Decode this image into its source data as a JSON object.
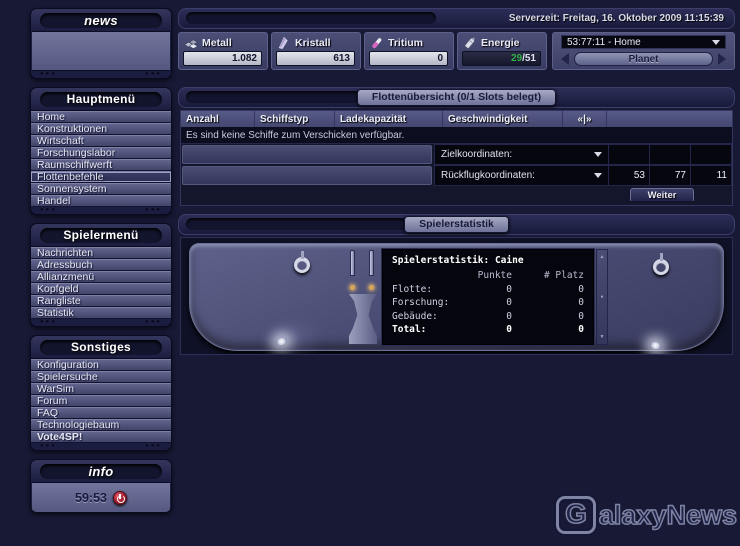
{
  "colors": {
    "background": "#171935",
    "panel_border": "#3c3f6b",
    "tab_silver": "#a6aac4",
    "energy_green": "#2fae47",
    "power_red": "#a11c2d",
    "selected_outline": "#9ba0c4",
    "decor_amber": "#d8a65a"
  },
  "sidebar": {
    "news_title": "news",
    "sections": [
      {
        "title": "Hauptmenü",
        "items": [
          {
            "label": "Home"
          },
          {
            "label": "Konstruktionen"
          },
          {
            "label": "Wirtschaft"
          },
          {
            "label": "Forschungslabor"
          },
          {
            "label": "Raumschiffwerft"
          },
          {
            "label": "Flottenbefehle",
            "selected": true
          },
          {
            "label": "Sonnensystem"
          },
          {
            "label": "Handel"
          }
        ]
      },
      {
        "title": "Spielermenü",
        "items": [
          {
            "label": "Nachrichten"
          },
          {
            "label": "Adressbuch"
          },
          {
            "label": "Allianzmenü"
          },
          {
            "label": "Kopfgeld"
          },
          {
            "label": "Rangliste"
          },
          {
            "label": "Statistik"
          }
        ]
      },
      {
        "title": "Sonstiges",
        "items": [
          {
            "label": "Konfiguration"
          },
          {
            "label": "Spielersuche"
          },
          {
            "label": "WarSim"
          },
          {
            "label": "Forum"
          },
          {
            "label": "FAQ"
          },
          {
            "label": "Technologiebaum"
          },
          {
            "label": "Vote4SP!",
            "bold": true
          }
        ]
      }
    ],
    "info": {
      "title": "info",
      "timer": "59:53",
      "power_icon": "power-icon"
    }
  },
  "topbar": {
    "server_time": "Serverzeit: Freitag, 16. Oktober 2009 11:15:39"
  },
  "resources": [
    {
      "label": "Metall",
      "value": "1.082",
      "icon": "metall-icon"
    },
    {
      "label": "Kristall",
      "value": "613",
      "icon": "kristall-icon"
    },
    {
      "label": "Tritium",
      "value": "0",
      "icon": "tritium-icon"
    },
    {
      "label": "Energie",
      "value_current": "29",
      "value_max": "/51",
      "icon": "energie-icon"
    }
  ],
  "planet": {
    "selected": "53:77:11 - Home",
    "button_label": "Planet",
    "dropdown_icon": "chevron-down-icon",
    "prev_icon": "planet-prev-arrow",
    "next_icon": "planet-next-arrow"
  },
  "fleet": {
    "title": "Flottenübersicht (0/1 Slots belegt)",
    "columns": [
      "Anzahl",
      "Schiffstyp",
      "Ladekapazität",
      "Geschwindigkeit"
    ],
    "pager": "«|»",
    "empty_message": "Es sind keine Schiffe zum Verschicken verfügbar.",
    "rows": [
      {
        "key": "target",
        "label": "Zielkoordinaten:",
        "coords": [
          "",
          "",
          ""
        ]
      },
      {
        "key": "return",
        "label": "Rückflugkoordinaten:",
        "coords": [
          "53",
          "77",
          "11"
        ]
      }
    ],
    "submit_label": "Weiter"
  },
  "stats": {
    "panel_title": "Spielerstatistik",
    "screen_title": "Spielerstatistik: Caine",
    "columns": {
      "points": "Punkte",
      "rank": "# Platz"
    },
    "rows": [
      {
        "label": "Flotte:",
        "points": "0",
        "rank": "0"
      },
      {
        "label": "Forschung:",
        "points": "0",
        "rank": "0"
      },
      {
        "label": "Gebäude:",
        "points": "0",
        "rank": "0"
      },
      {
        "label": "Total:",
        "points": "0",
        "rank": "0",
        "bold": true
      }
    ]
  },
  "watermark": {
    "g": "G",
    "rest": "alaxyNews"
  }
}
